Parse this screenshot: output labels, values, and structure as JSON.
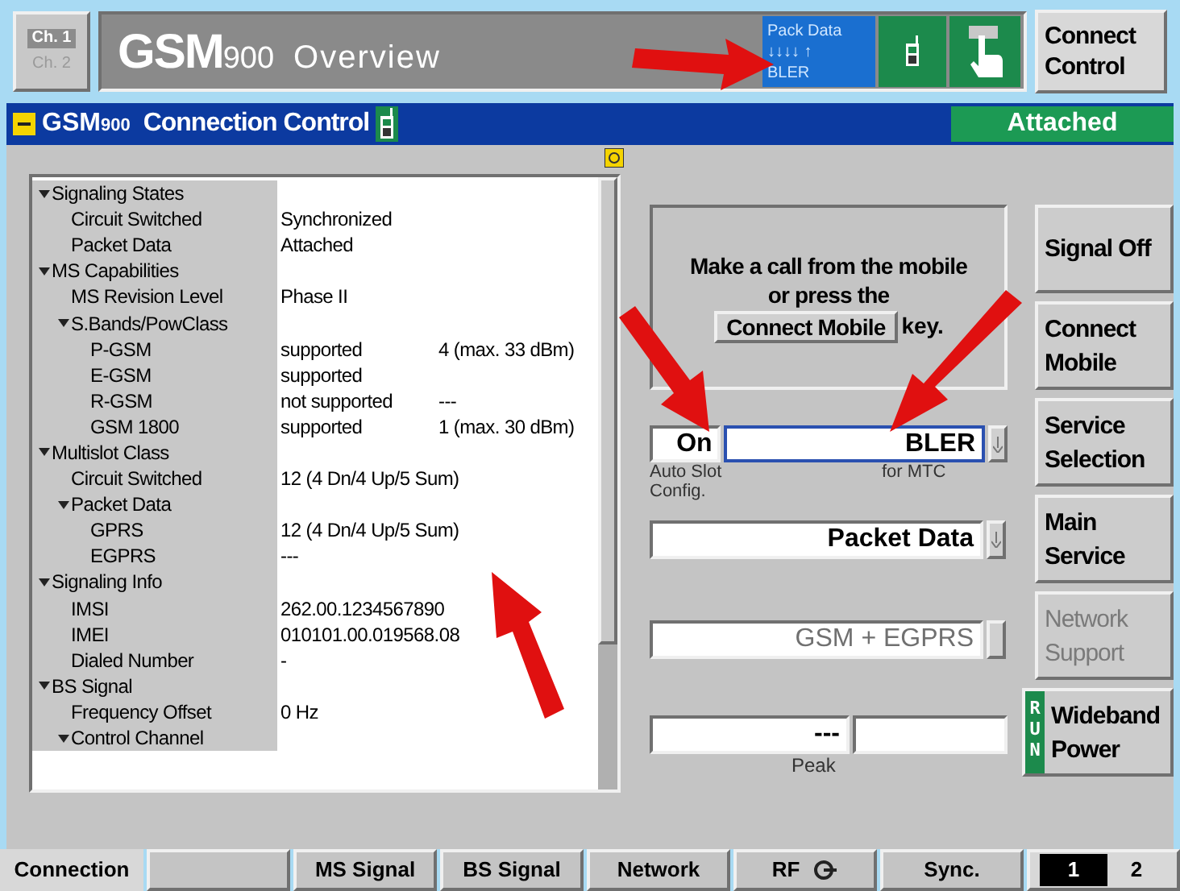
{
  "channels": [
    {
      "label": "Ch. 1",
      "selected": true
    },
    {
      "label": "Ch. 2",
      "selected": false
    }
  ],
  "header": {
    "title": "GSM",
    "title_sub": "900",
    "subtitle": "Overview",
    "status_lines": [
      "Pack Data",
      "↓↓↓↓ ↑",
      "BLER"
    ]
  },
  "connect_control_button": "Connect Control",
  "panel": {
    "title": "GSM",
    "title_sub": "900",
    "title_rest": "Connection Control",
    "status": "Attached"
  },
  "tree": [
    {
      "label": "Signaling States",
      "expanded": true,
      "children": [
        {
          "label": "Circuit Switched",
          "value": "Synchronized"
        },
        {
          "label": "Packet Data",
          "value": "Attached"
        }
      ]
    },
    {
      "label": "MS Capabilities",
      "expanded": true,
      "children": [
        {
          "label": "MS Revision Level",
          "value": "Phase II"
        },
        {
          "label": "S.Bands/PowClass",
          "expanded": true,
          "children": [
            {
              "label": "P-GSM",
              "value": "supported",
              "value_2": "4 (max. 33 dBm)"
            },
            {
              "label": "E-GSM",
              "value": "supported"
            },
            {
              "label": "R-GSM",
              "value": "not supported",
              "value_2": "---"
            },
            {
              "label": "GSM 1800",
              "value": "supported",
              "value_2": "1 (max. 30 dBm)"
            }
          ]
        }
      ]
    },
    {
      "label": "Multislot Class",
      "expanded": true,
      "children": [
        {
          "label": "Circuit Switched",
          "value": "12 (4 Dn/4 Up/5 Sum)"
        },
        {
          "label": "Packet Data",
          "expanded": true,
          "children": [
            {
              "label": "GPRS",
              "value": "12 (4 Dn/4 Up/5 Sum)"
            },
            {
              "label": "EGPRS",
              "value": "---"
            }
          ]
        }
      ]
    },
    {
      "label": "Signaling Info",
      "expanded": true,
      "children": [
        {
          "label": "IMSI",
          "value": "262.00.1234567890"
        },
        {
          "label": "IMEI",
          "value": "010101.00.019568.08"
        },
        {
          "label": "Dialed Number",
          "value": "-"
        }
      ]
    },
    {
      "label": "BS Signal",
      "expanded": true,
      "children": [
        {
          "label": "Frequency Offset",
          "value": "0  Hz"
        },
        {
          "label": "Control Channel",
          "expanded": true
        }
      ]
    }
  ],
  "message": {
    "text": "Make a call from the mobile or press the",
    "button": "Connect Mobile",
    "text_after": "key."
  },
  "slot_config": {
    "value": "On",
    "label": "Auto Slot Config."
  },
  "test_mode": {
    "value": "BLER",
    "label": "for MTC"
  },
  "main_service": {
    "value": "Packet Data"
  },
  "network_support": {
    "value": "GSM + EGPRS",
    "disabled": true
  },
  "power_reading": {
    "value": "---",
    "label": "Peak"
  },
  "softkeys": [
    {
      "label": "Signal Off",
      "disabled": false
    },
    {
      "label": "Connect Mobile",
      "disabled": false
    },
    {
      "label": "Service Selection",
      "disabled": false
    },
    {
      "label": "Main Service",
      "disabled": false
    },
    {
      "label": "Network Support",
      "disabled": true
    },
    {
      "label": "Wideband Power",
      "disabled": false,
      "run": "RUN"
    }
  ],
  "tabs": [
    {
      "label": "Connection",
      "selected": true
    },
    {
      "selected": false
    },
    {
      "label": "MS Signal",
      "selected": false
    },
    {
      "label": "BS Signal",
      "selected": false
    },
    {
      "label": "Network",
      "selected": false
    },
    {
      "label": "RF",
      "selected": false,
      "kind": "rf"
    },
    {
      "label": "Sync.",
      "selected": false
    }
  ],
  "pages": [
    {
      "label": "1",
      "selected": true
    },
    {
      "label": "2",
      "selected": false
    }
  ]
}
